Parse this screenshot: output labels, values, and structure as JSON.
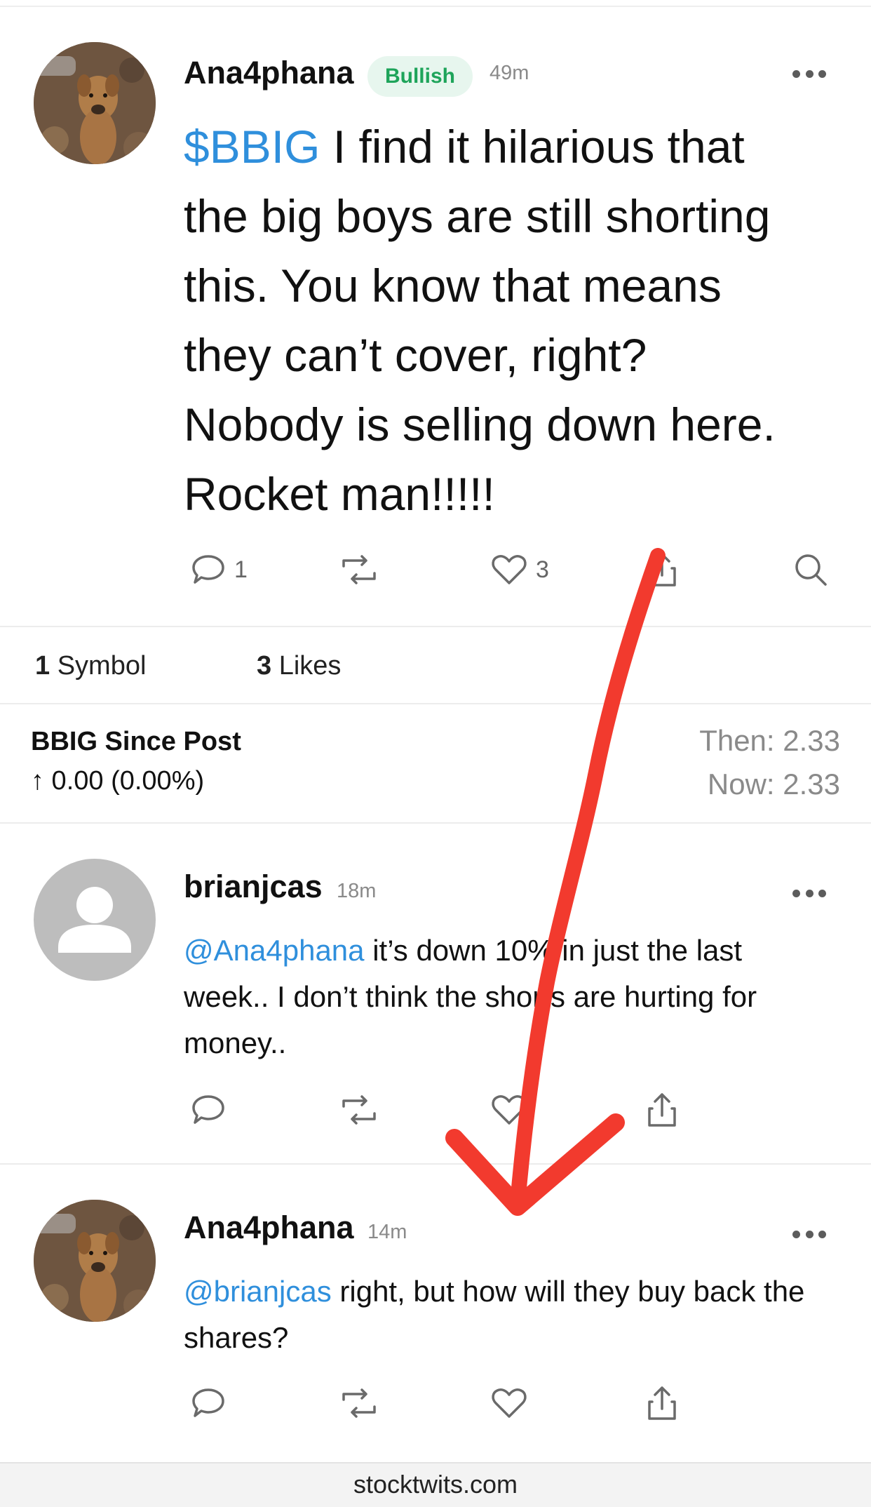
{
  "post1": {
    "username": "Ana4phana",
    "sentiment": "Bullish",
    "time": "49m",
    "ticker": "$BBIG",
    "text": " I find it hilarious that the big boys are still shorting this.  You know that means they can’t cover, right? Nobody is selling down here. Rocket man!!!!!",
    "comments": "1",
    "likes": "3"
  },
  "stats": {
    "symbol_count": "1",
    "symbol_label": "Symbol",
    "likes_count": "3",
    "likes_label": "Likes"
  },
  "since_post": {
    "title": "BBIG Since Post",
    "change": "↑ 0.00 (0.00%)",
    "then": "Then: 2.33",
    "now": "Now: 2.33"
  },
  "reply1": {
    "username": "brianjcas",
    "time": "18m",
    "mention": "@Ana4phana",
    "text": " it’s down 10% in just the last week.. I don’t think the shorts are hurting for money.."
  },
  "reply2": {
    "username": "Ana4phana",
    "time": "14m",
    "mention": "@brianjcas",
    "text": " right, but how will they buy back the shares?"
  },
  "footer": {
    "domain": "stocktwits.com"
  },
  "colors": {
    "mention": "#2f8fdc",
    "bullish_bg": "#e7f6ee",
    "bullish_text": "#1ea45a",
    "annotation_arrow": "#f23a2e"
  },
  "icons": [
    "comment-icon",
    "reshare-icon",
    "like-icon",
    "share-icon",
    "search-icon",
    "more-icon",
    "user-placeholder-icon"
  ]
}
